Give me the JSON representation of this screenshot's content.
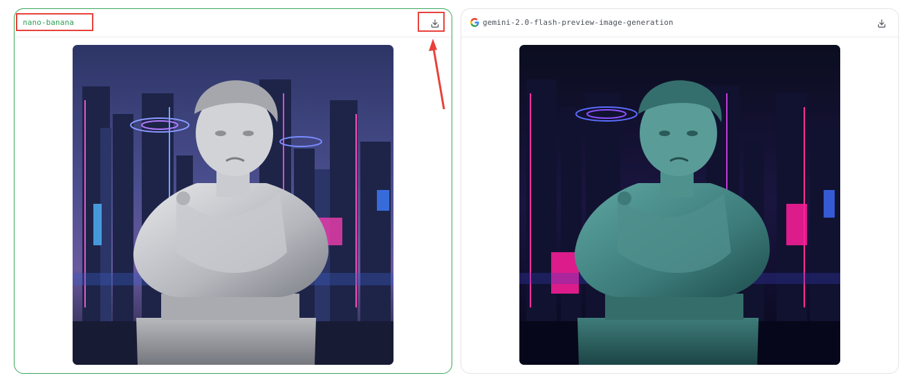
{
  "panels": [
    {
      "model_name": "nano-banana",
      "selected": true,
      "download_icon": "download-icon",
      "image_subject": "white marble bust in front of cyberpunk city"
    },
    {
      "model_name": "gemini-2.0-flash-preview-image-generation",
      "selected": false,
      "provider_icon": "google-g-icon",
      "download_icon": "download-icon",
      "image_subject": "teal-tinted bust in front of neon pink cyberpunk city"
    }
  ],
  "colors": {
    "selected_border": "#3aa55c",
    "selected_text": "#2f9e55",
    "annotation_red": "#e8403a",
    "neutral_border": "#e2e3e6"
  }
}
